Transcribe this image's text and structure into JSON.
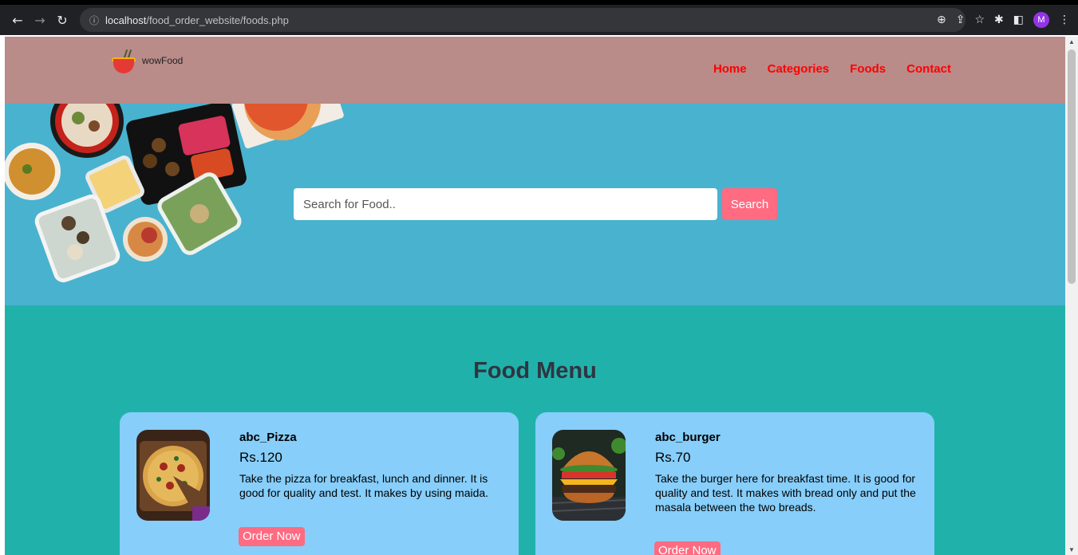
{
  "browser": {
    "url_host": "localhost",
    "url_path": "/food_order_website/foods.php",
    "profile_initial": "M"
  },
  "site": {
    "logo_text": "wowFood",
    "nav": [
      {
        "label": "Home"
      },
      {
        "label": "Categories"
      },
      {
        "label": "Foods"
      },
      {
        "label": "Contact"
      }
    ]
  },
  "search": {
    "placeholder": "Search for Food..",
    "button_label": "Search"
  },
  "menu": {
    "title": "Food Menu",
    "items": [
      {
        "name": "abc_Pizza",
        "price": "Rs.120",
        "description": "Take the pizza for breakfast, lunch and dinner. It is good for quality and test. It makes by using maida.",
        "button_label": "Order Now"
      },
      {
        "name": "abc_burger",
        "price": "Rs.70",
        "description": "Take the burger here for breakfast time. It is good for quality and test. It makes with bread only and put the masala between the two breads.",
        "button_label": "Order Now"
      }
    ]
  },
  "colors": {
    "navbar": "#b98b89",
    "hero": "#49b2cf",
    "menu_section": "#20b2aa",
    "card": "#87cefa",
    "accent": "#ff6b81",
    "nav_link": "#ff0000"
  }
}
